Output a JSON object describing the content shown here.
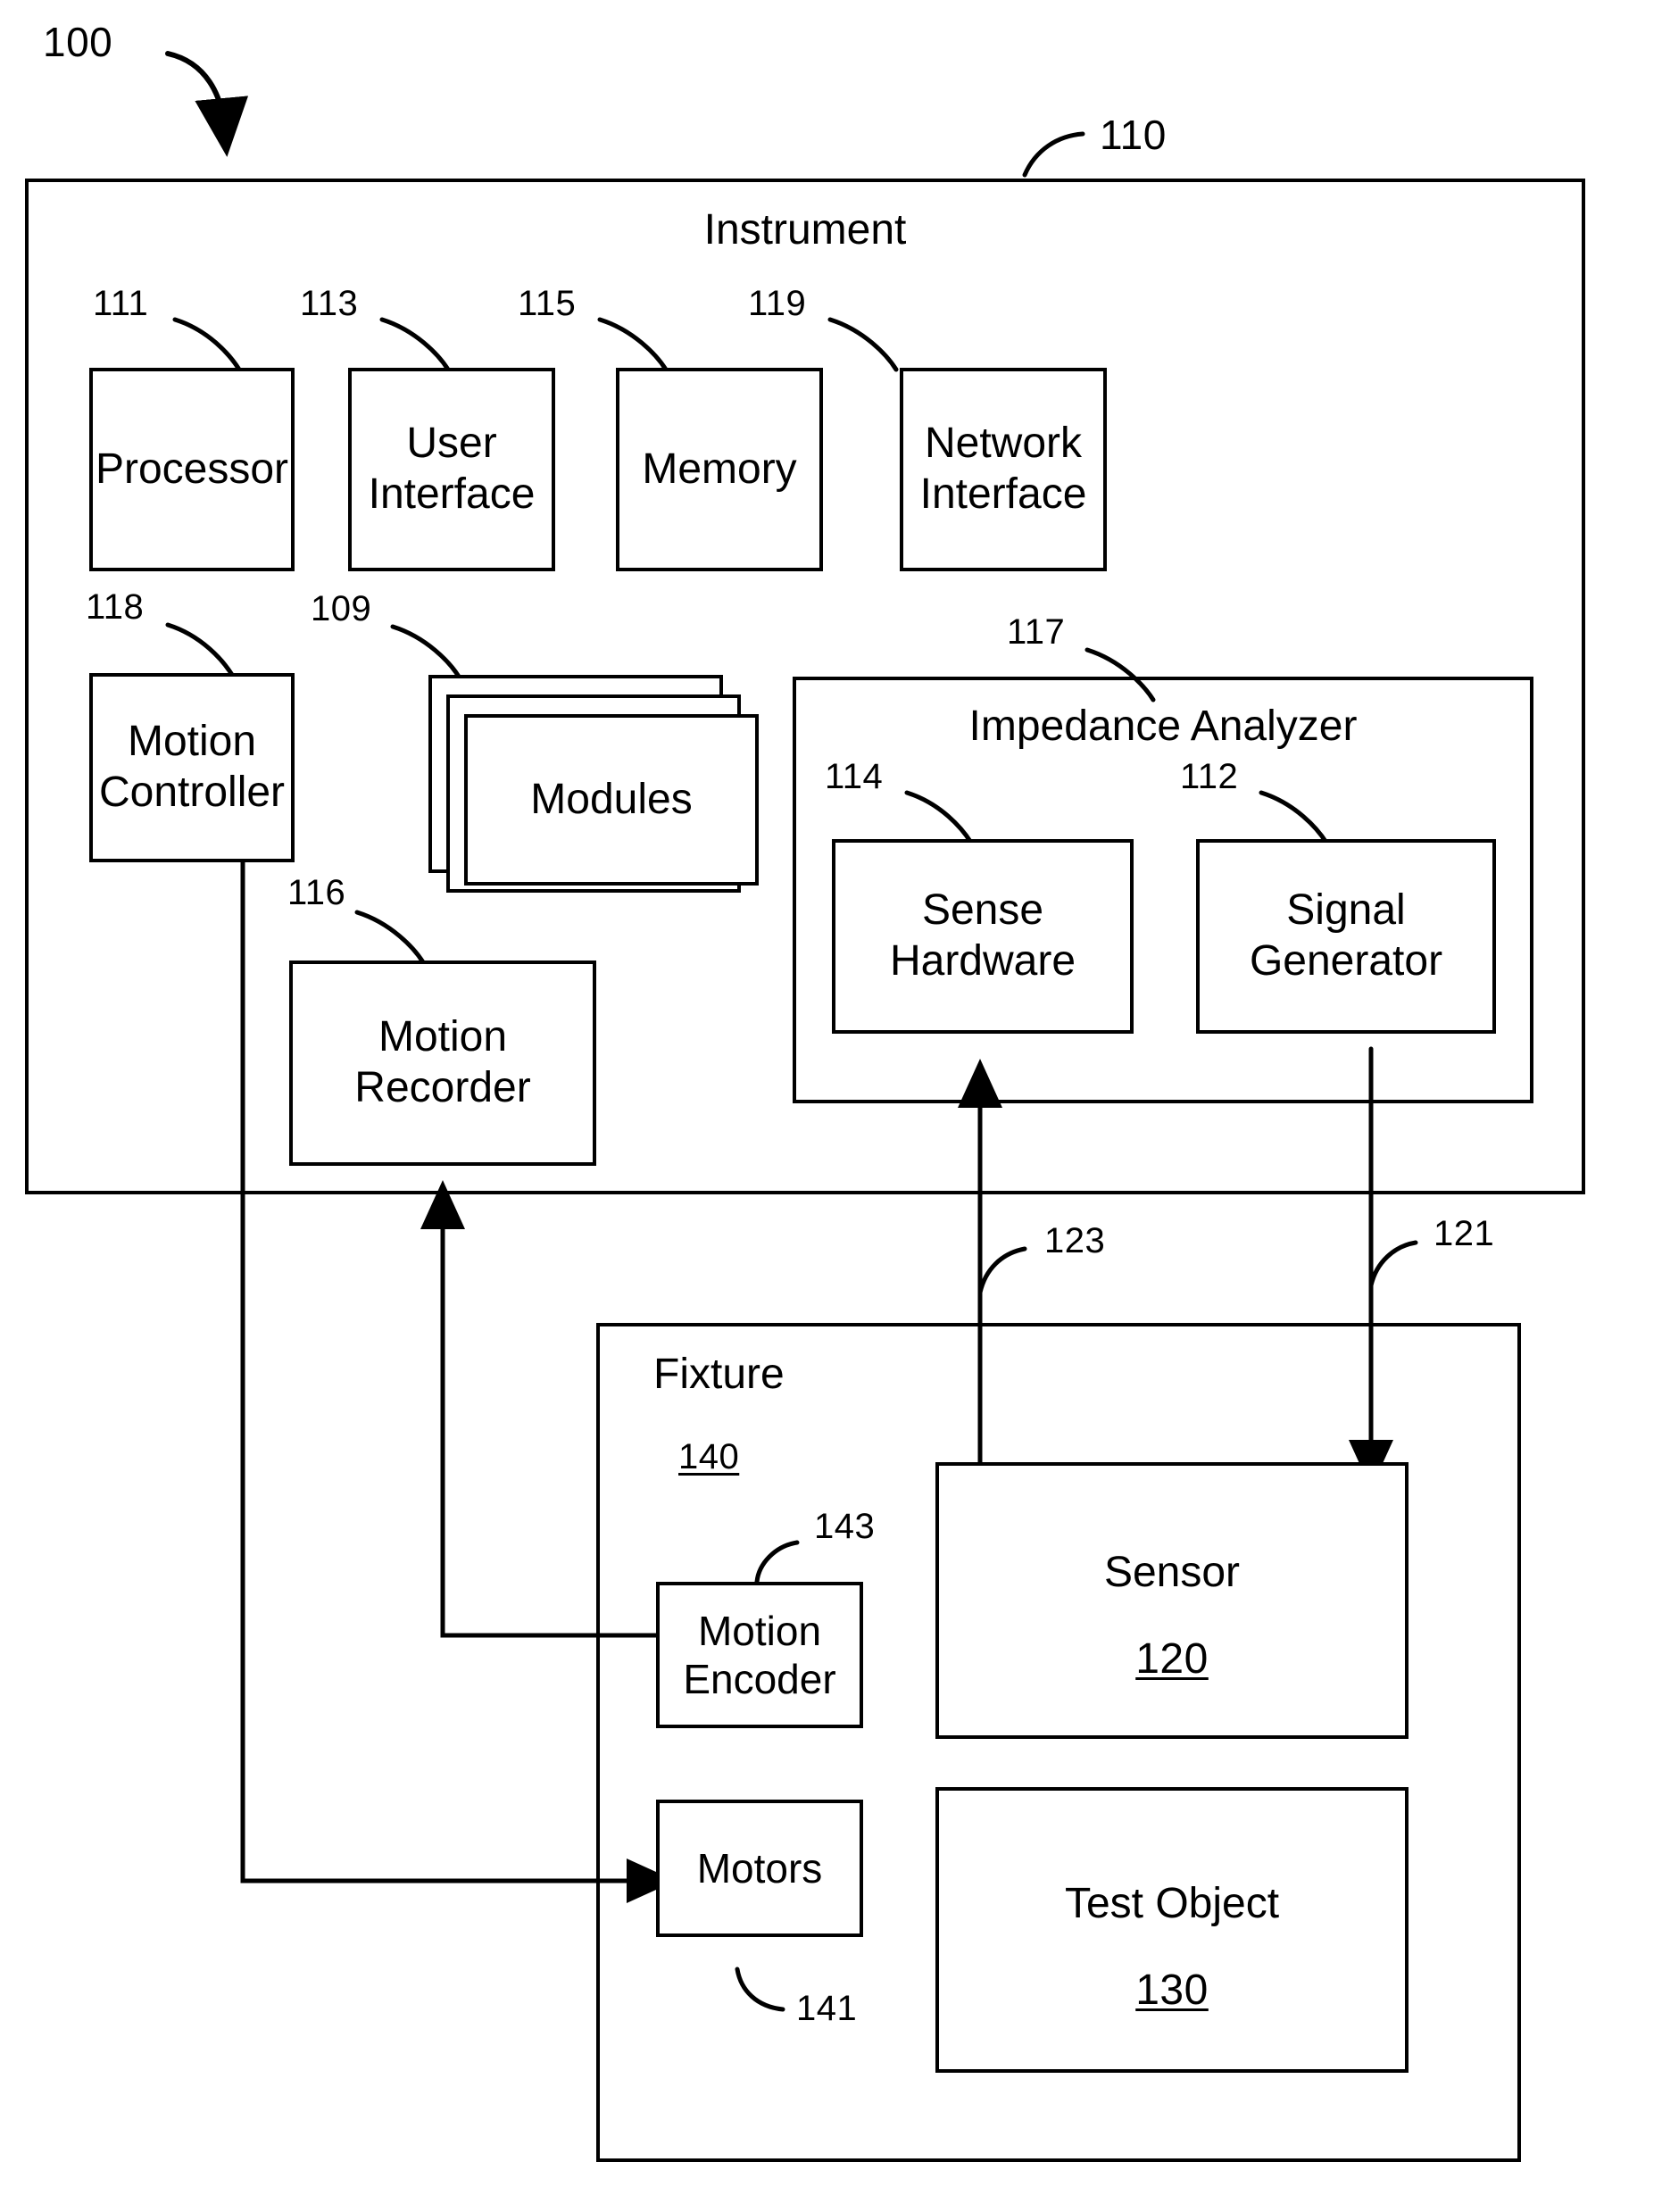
{
  "figure": {
    "system_ref": "100",
    "instrument": {
      "title": "Instrument",
      "ref": "110",
      "components": [
        {
          "label": "Processor",
          "ref": "111"
        },
        {
          "label": "User\nInterface",
          "ref": "113"
        },
        {
          "label": "Memory",
          "ref": "115"
        },
        {
          "label": "Network\nInterface",
          "ref": "119"
        },
        {
          "label": "Motion\nController",
          "ref": "118"
        },
        {
          "label": "Modules",
          "ref": "109"
        },
        {
          "label": "Motion\nRecorder",
          "ref": "116"
        }
      ],
      "impedance_analyzer": {
        "title": "Impedance Analyzer",
        "ref": "117",
        "components": [
          {
            "label": "Sense\nHardware",
            "ref": "114"
          },
          {
            "label": "Signal\nGenerator",
            "ref": "112"
          }
        ]
      }
    },
    "fixture": {
      "title": "Fixture",
      "ref": "140",
      "components": [
        {
          "label": "Motion\nEncoder",
          "ref": "143"
        },
        {
          "label": "Motors",
          "ref": "141"
        },
        {
          "label": "Sensor",
          "ref": "120"
        },
        {
          "label": "Test Object",
          "ref": "130"
        }
      ]
    },
    "signal_refs": [
      {
        "ref": "123",
        "from": "Sensor",
        "to": "Sense Hardware"
      },
      {
        "ref": "121",
        "from": "Signal Generator",
        "to": "Sensor"
      }
    ]
  }
}
